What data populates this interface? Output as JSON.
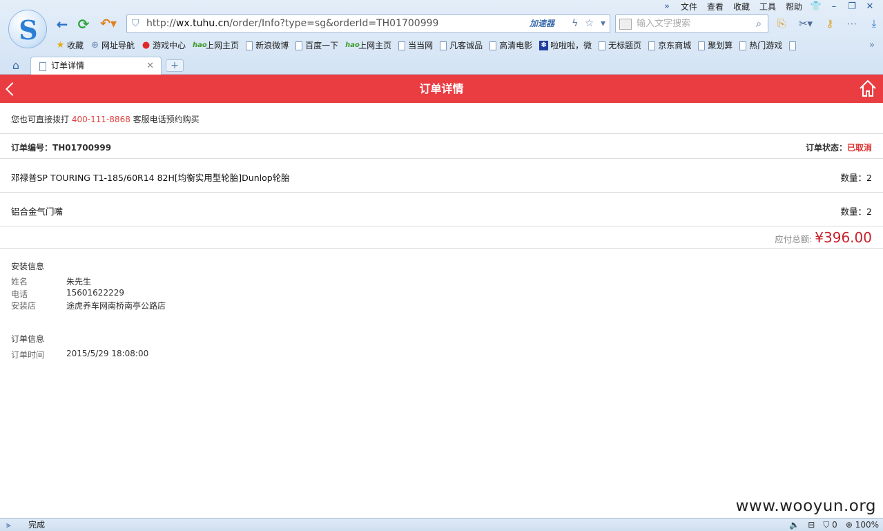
{
  "browser": {
    "menu": [
      "文件",
      "查看",
      "收藏",
      "工具",
      "帮助"
    ],
    "window_buttons": {
      "skin": "👕",
      "minimize": "–",
      "restore": "❐",
      "close": "✕",
      "more": "»"
    },
    "address": {
      "scheme": "http://",
      "host": "wx.tuhu.cn",
      "path": "/order/Info?type=sg&orderId=TH01700999",
      "accelerator": "加速器"
    },
    "search": {
      "placeholder": "输入文字搜索"
    },
    "bookmarks": [
      {
        "label": "收藏",
        "icon": "star-icon"
      },
      {
        "label": "网址导航",
        "icon": "globe-icon"
      },
      {
        "label": "游戏中心",
        "icon": "game-icon"
      },
      {
        "label": "上网主页",
        "icon": "hao-icon"
      },
      {
        "label": "新浪微博",
        "icon": "page-icon"
      },
      {
        "label": "百度一下",
        "icon": "page-icon"
      },
      {
        "label": "上网主页",
        "icon": "hao-icon"
      },
      {
        "label": "当当网",
        "icon": "page-icon"
      },
      {
        "label": "凡客诚品",
        "icon": "page-icon"
      },
      {
        "label": "高清电影",
        "icon": "page-icon"
      },
      {
        "label": "啦啦啦，微",
        "icon": "paw-icon"
      },
      {
        "label": "无标题页",
        "icon": "page-icon"
      },
      {
        "label": "京东商城",
        "icon": "page-icon"
      },
      {
        "label": "聚划算",
        "icon": "page-icon"
      },
      {
        "label": "热门游戏",
        "icon": "page-icon"
      }
    ],
    "tab": {
      "title": "订单详情",
      "close": "✕",
      "new": "+"
    },
    "status": {
      "text": "完成",
      "count": "0",
      "zoom": "100%"
    }
  },
  "page": {
    "title": "订单详情",
    "notice": {
      "prefix": "您也可直接拨打 ",
      "phone": "400-111-8868",
      "suffix": " 客服电话预约购买"
    },
    "order": {
      "number_label": "订单编号：",
      "number": "TH01700999",
      "status_label": "订单状态：",
      "status": "已取消"
    },
    "items": [
      {
        "name": "邓禄普SP TOURING T1-185/60R14 82H[均衡实用型轮胎]Dunlop轮胎",
        "qty_label": "数量：",
        "qty": "2"
      },
      {
        "name": "铝合金气门嘴",
        "qty_label": "数量：",
        "qty": "2"
      }
    ],
    "total": {
      "label": "应付总额:",
      "amount": "¥396.00"
    },
    "install": {
      "title": "安装信息",
      "name_label": "姓名",
      "name": "朱先生",
      "phone_label": "电话",
      "phone": "15601622229",
      "store_label": "安装店",
      "store": "途虎养车网南桥南亭公路店"
    },
    "order_info": {
      "title": "订单信息",
      "time_label": "订单时间",
      "time": "2015/5/29 18:08:00"
    }
  },
  "watermark": "www.wooyun.org",
  "colors": {
    "accent_red": "#ea3d42",
    "price_red": "#c8202a",
    "chrome_blue": "#d3e3f4"
  }
}
